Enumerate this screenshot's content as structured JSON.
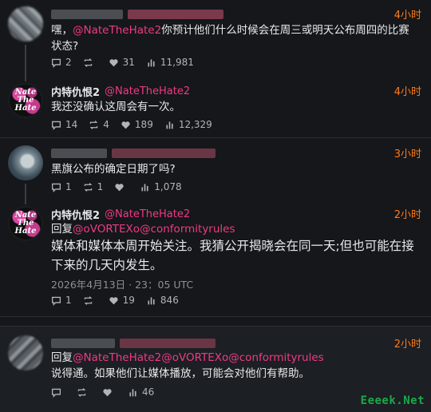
{
  "tweets": [
    {
      "time": "4小时",
      "text_prefix": "嘿，",
      "mention": "@NateTheHate2",
      "text": "你预计他们什么时候会在周三或明天公布周四的比赛状态?",
      "stats": {
        "replies": "2",
        "retweets": "",
        "likes": "31",
        "views": "11,981"
      }
    },
    {
      "name": "内特仇恨2",
      "handle": "@NateTheHate2",
      "time": "4小时",
      "text": "我还没确认这周会有一次。",
      "avatar_text": "Nate The Hate",
      "stats": {
        "replies": "14",
        "retweets": "4",
        "likes": "189",
        "views": "12,329"
      }
    },
    {
      "time": "3小时",
      "text": "黑旗公布的确定日期了吗?",
      "stats": {
        "replies": "1",
        "retweets": "1",
        "likes": "",
        "views": "1,078"
      }
    },
    {
      "name": "内特仇恨2",
      "handle": "@NateTheHate2",
      "time": "2小时",
      "reply_label": "回复",
      "reply_mentions": "@oVORTEXo@conformityrules",
      "text": "媒体和媒体本周开始关注。我猜公开揭晓会在同一天;但也可能在接下来的几天内发生。",
      "timestamp": "2026年4月13日 · 23：05 UTC",
      "avatar_text": "Nate The Hate",
      "stats": {
        "replies": "1",
        "retweets": "",
        "likes": "19",
        "views": "846"
      }
    },
    {
      "time": "2小时",
      "reply_label": "回复",
      "reply_mentions": "@NateTheHate2@oVORTEXo@conformityrules",
      "text": "说得通。如果他们让媒体播放，可能会对他们有帮助。",
      "stats": {
        "replies": "",
        "retweets": "",
        "likes": "",
        "views": "46"
      }
    }
  ],
  "watermark": "Eeeek.Net",
  "colors": {
    "accent_time": "#ff7a1a",
    "mention": "#ef3a86",
    "watermark": "#1ba84a"
  },
  "icons": [
    "reply-icon",
    "retweet-icon",
    "like-icon",
    "views-icon"
  ]
}
